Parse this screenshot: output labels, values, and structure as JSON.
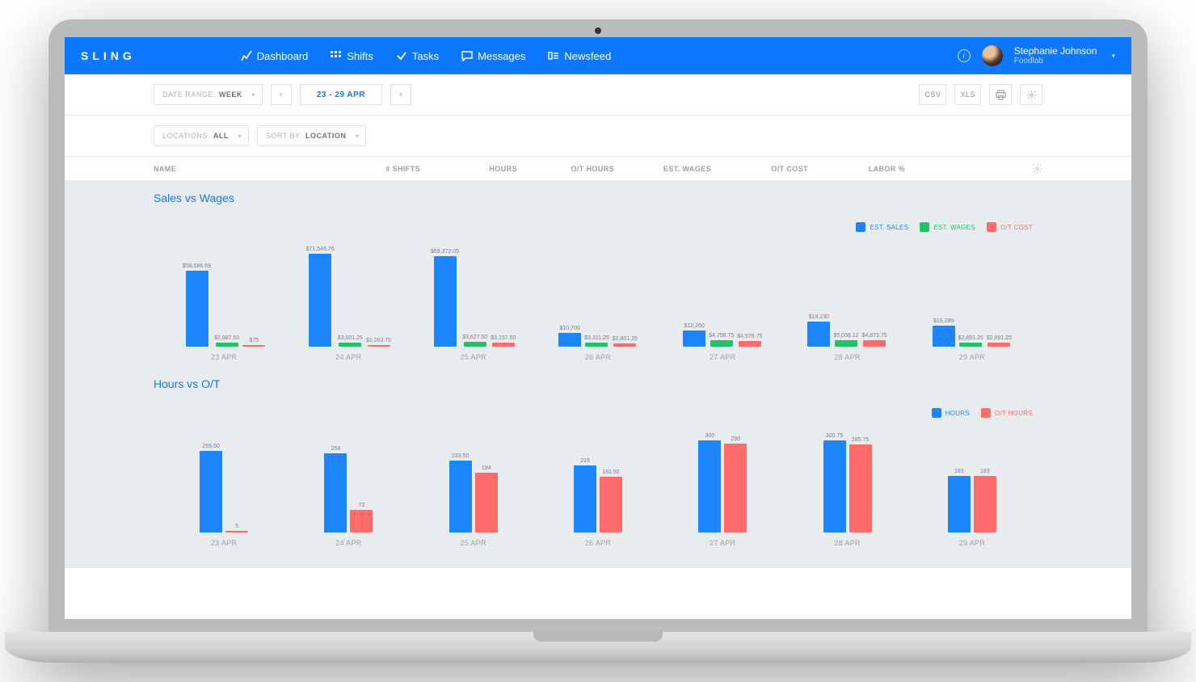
{
  "brand": "SLING",
  "nav": {
    "dashboard": "Dashboard",
    "shifts": "Shifts",
    "tasks": "Tasks",
    "messages": "Messages",
    "newsfeed": "Newsfeed"
  },
  "user": {
    "name": "Stephanie Johnson",
    "org": "Foodlab"
  },
  "toolbar": {
    "date_range_label": "DATE RANGE:",
    "date_range_value": "WEEK",
    "date_display": "23 - 29 APR",
    "csv": "CSV",
    "xls": "XLS",
    "locations_label": "LOCATIONS:",
    "locations_value": "ALL",
    "sortby_label": "SORT BY:",
    "sortby_value": "LOCATION"
  },
  "columns": {
    "name": "NAME",
    "shifts": "# SHIFTS",
    "hours": "HOURS",
    "ot_hours": "O/T HOURS",
    "est_wages": "EST. WAGES",
    "ot_cost": "O/T COST",
    "labor_pct": "LABOR %"
  },
  "sections": {
    "sales_vs_wages": "Sales vs Wages",
    "hours_vs_ot": "Hours vs O/T"
  },
  "legend1": {
    "a": "EST. SALES",
    "b": "EST. WAGES",
    "c": "O/T COST"
  },
  "legend2": {
    "a": "HOURS",
    "b": "O/T HOURS"
  },
  "chart_data": [
    {
      "type": "bar",
      "title": "Sales vs Wages",
      "categories": [
        "23 APR",
        "24 APR",
        "25 APR",
        "26 APR",
        "27 APR",
        "28 APR",
        "29 APR"
      ],
      "series": [
        {
          "name": "EST. SALES",
          "color": "#1d86ff",
          "values": [
            58086.69,
            71546.76,
            69372.05,
            10700,
            12260,
            19230,
            16289
          ],
          "labels": [
            "$58,086.69",
            "$71,546.76",
            "$69,372.05",
            "$10,700",
            "$12,260",
            "$19,230",
            "$16,289"
          ]
        },
        {
          "name": "EST. WAGES",
          "color": "#21c268",
          "values": [
            2987.5,
            3001.25,
            3627.5,
            3311.25,
            4758.75,
            5038.12,
            2891.25
          ],
          "labels": [
            "$2,987.50",
            "$3,001.25",
            "$3,627.50",
            "$3,311.25",
            "$4,758.75",
            "$5,038.12",
            "$2,891.25"
          ]
        },
        {
          "name": "O/T COST",
          "color": "#ff6b6b",
          "values": [
            75,
            1263.75,
            3157.5,
            2801.25,
            4578.75,
            4875.75,
            2891.25
          ],
          "labels": [
            "$75",
            "$1,263.75",
            "$3,157.50",
            "$2,801.25",
            "$4,578.75",
            "$4,875.75",
            "$2,891.25"
          ]
        }
      ],
      "ylim": [
        0,
        72000
      ]
    },
    {
      "type": "bar",
      "title": "Hours vs O/T",
      "categories": [
        "23 APR",
        "24 APR",
        "25 APR",
        "26 APR",
        "27 APR",
        "28 APR",
        "29 APR"
      ],
      "series": [
        {
          "name": "HOURS",
          "color": "#1d86ff",
          "values": [
            265.5,
            258,
            233.5,
            219,
            300,
            300.75,
            183
          ],
          "labels": [
            "265.50",
            "258",
            "233.50",
            "219",
            "300",
            "300.75",
            "183"
          ]
        },
        {
          "name": "O/T HOURS",
          "color": "#ff6b6b",
          "values": [
            5,
            73,
            194,
            181.5,
            290,
            285.75,
            183
          ],
          "labels": [
            "5",
            "73",
            "194",
            "181.50",
            "290",
            "285.75",
            "183"
          ]
        }
      ],
      "ylim": [
        0,
        305
      ]
    }
  ]
}
